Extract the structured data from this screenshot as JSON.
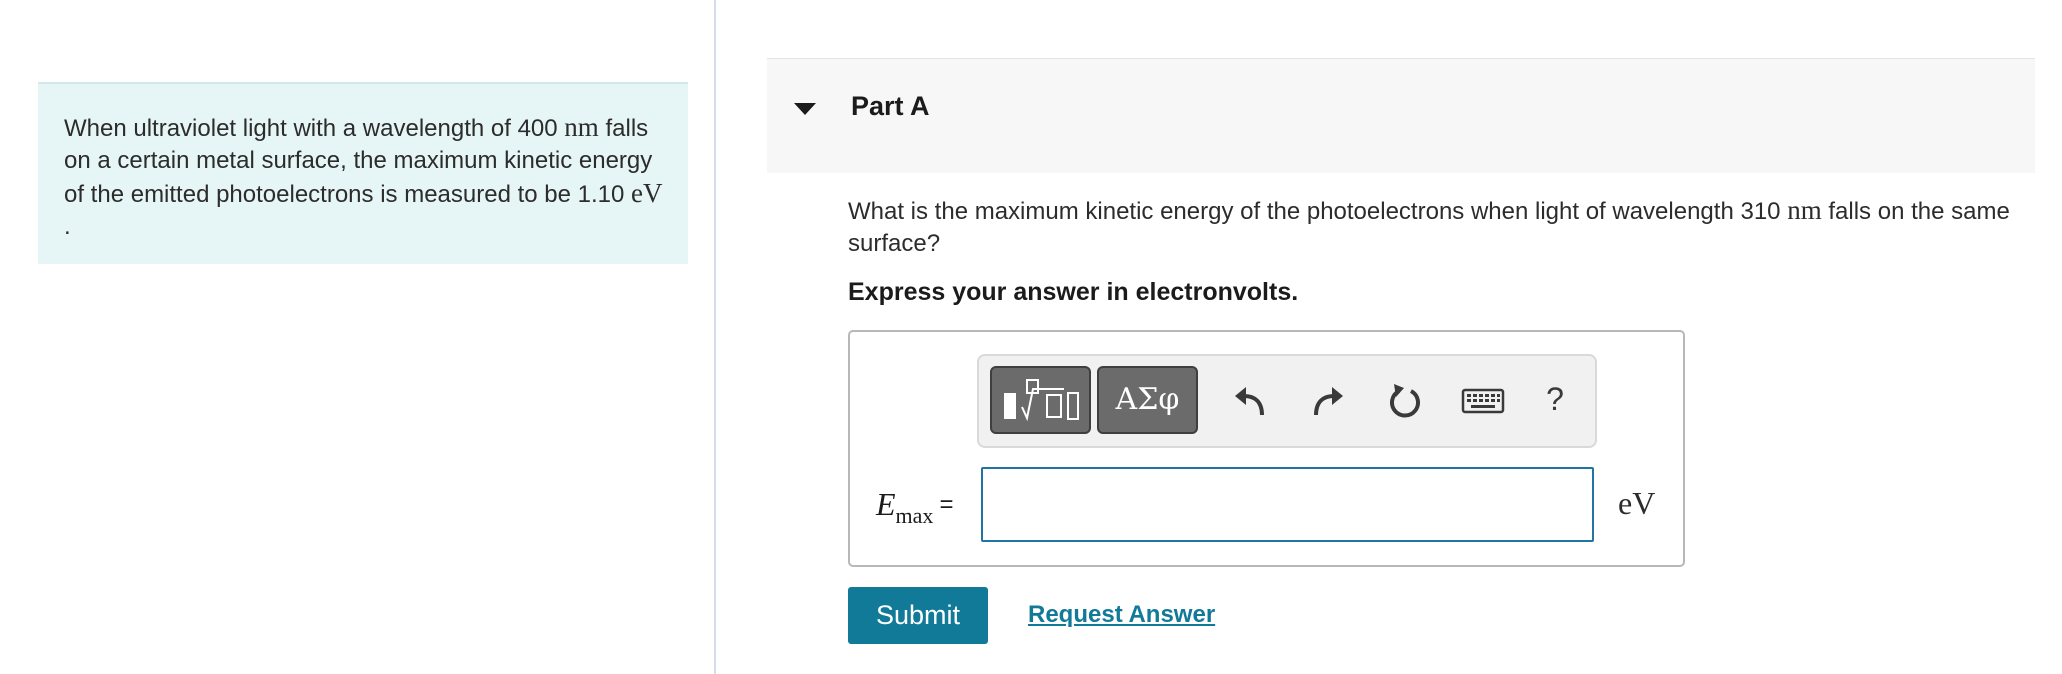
{
  "intro": {
    "text_1": "When ultraviolet light with a wavelength of 400 ",
    "wavelength_unit": "nm",
    "text_2": " falls on a certain metal surface, the maximum kinetic energy of the emitted photoelectrons is measured to be 1.10 ",
    "energy_unit": "eV",
    "text_3": " ."
  },
  "part": {
    "title": "Part A",
    "question_1": "What is the maximum kinetic energy of the photoelectrons when light of wavelength 310 ",
    "question_unit": "nm",
    "question_2": " falls on the same surface?",
    "instruction": "Express your answer in electronvolts."
  },
  "toolbar": {
    "templates_icon": "fraction-sqrt-templates-icon",
    "greek_label": "ΑΣφ",
    "undo_icon": "undo-arrow-icon",
    "redo_icon": "redo-arrow-icon",
    "reset_icon": "reset-circular-arrow-icon",
    "keyboard_icon": "keyboard-icon",
    "help_label": "?"
  },
  "answer": {
    "variable": "E",
    "subscript": "max",
    "equals": "=",
    "value": "",
    "placeholder": "",
    "unit": "eV"
  },
  "actions": {
    "submit_label": "Submit",
    "request_answer_label": "Request Answer"
  },
  "colors": {
    "intro_background": "#e6f5f6",
    "accent": "#117a99",
    "input_border": "#2274a5",
    "header_background": "#f7f7f7"
  }
}
